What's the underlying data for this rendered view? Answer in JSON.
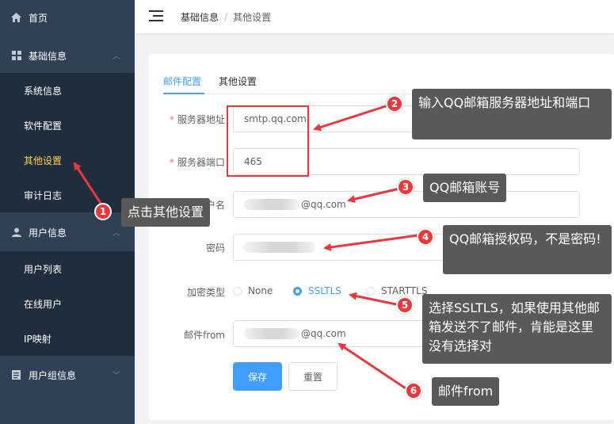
{
  "sidebar": {
    "items": [
      {
        "label": "首页",
        "icon": "home-icon"
      },
      {
        "label": "基础信息",
        "icon": "grid-icon"
      },
      {
        "label": "系统信息"
      },
      {
        "label": "软件配置"
      },
      {
        "label": "其他设置"
      },
      {
        "label": "审计日志"
      },
      {
        "label": "用户信息",
        "icon": "user-icon"
      },
      {
        "label": "用户列表"
      },
      {
        "label": "在线用户"
      },
      {
        "label": "IP映射"
      },
      {
        "label": "用户组信息",
        "icon": "document-icon"
      }
    ]
  },
  "header": {
    "breadcrumb": [
      "基础信息",
      "其他设置"
    ]
  },
  "tabs": [
    "邮件配置",
    "其他设置"
  ],
  "form": {
    "server_address": {
      "label": "服务器地址",
      "value": "smtp.qq.com"
    },
    "server_port": {
      "label": "服务器端口",
      "value": "465"
    },
    "username": {
      "label": "用户名",
      "value": "@qq.com"
    },
    "password": {
      "label": "密码"
    },
    "encryption": {
      "label": "加密类型",
      "options": [
        "None",
        "SSLTLS",
        "STARTTLS"
      ],
      "selected": "SSLTLS"
    },
    "mail_from": {
      "label": "邮件from",
      "value": "@qq.com"
    },
    "save_label": "保存",
    "reset_label": "重置"
  },
  "annotations": [
    {
      "number": "1",
      "text": "点击其他设置"
    },
    {
      "number": "2",
      "text": "输入QQ邮箱服务器地址和端口"
    },
    {
      "number": "3",
      "text": "QQ邮箱账号"
    },
    {
      "number": "4",
      "text": "QQ邮箱授权码，不是密码!"
    },
    {
      "number": "5",
      "text": "选择SSLTLS，如果使用其他邮箱发送不了邮件，肯能是这里没有选择对"
    },
    {
      "number": "6",
      "text": "邮件from"
    }
  ],
  "colors": {
    "sidebar_bg": "#304156",
    "submenu_bg": "#1f2d3d",
    "active_menu": "#ffd04b",
    "primary": "#409eff",
    "annotation_red": "#e8383d",
    "note_bg": "#595959"
  }
}
